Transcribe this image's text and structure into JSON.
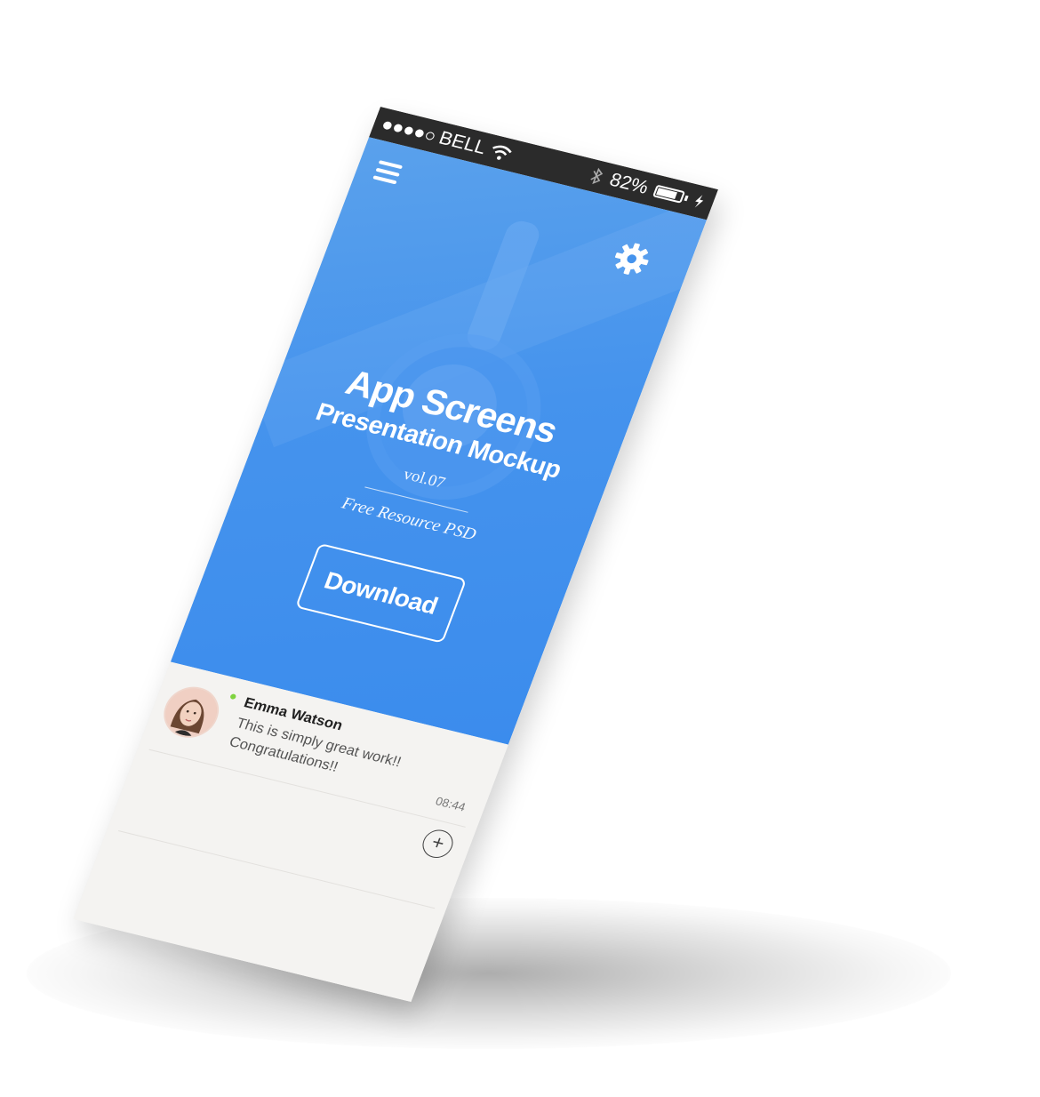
{
  "statusbar": {
    "carrier": "BELL",
    "signal_dots": 5,
    "signal_filled": 4,
    "battery_label": "82%",
    "battery_level": 0.82,
    "icons": [
      "signal-dots-icon",
      "wifi-icon",
      "bluetooth-icon",
      "battery-icon",
      "charging-icon"
    ]
  },
  "hero": {
    "title": "App Screens",
    "subtitle": "Presentation Mockup",
    "version": "vol.07",
    "resource": "Free Resource PSD",
    "download_label": "Download",
    "background_color": "#4593ed",
    "icons": [
      "menu-icon",
      "gear-icon"
    ]
  },
  "feed": {
    "item": {
      "name": "Emma Watson",
      "message_line_1": "This is simply great work!!",
      "message_line_2": "Congratulations!!",
      "time": "08:44",
      "online_color": "#7fd33f"
    },
    "icons": [
      "avatar",
      "plus-icon"
    ]
  }
}
